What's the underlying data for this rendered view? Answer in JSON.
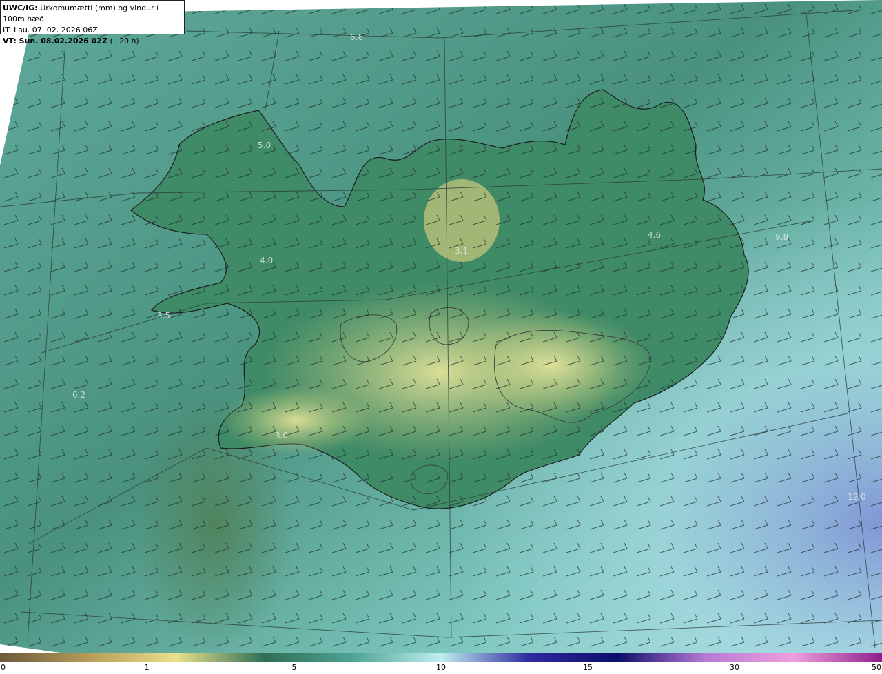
{
  "header": {
    "model_label": "UWC/IG:",
    "title": "Úrkomumætti (mm) og vindur í 100m hæð",
    "it_line": "IT: Lau. 07. 02. 2026 06Z",
    "vt_label": "VT: Sun. 08.02.2026 02Z",
    "vt_offset": "(+20 h)"
  },
  "colorbar": {
    "ticks": [
      "0",
      "1",
      "5",
      "10",
      "15",
      "30",
      "50"
    ],
    "colors": [
      "#6b5a3a",
      "#b79b5a",
      "#e9e08c",
      "#2f6e55",
      "#4fa394",
      "#bfeef0",
      "#2f2aa0",
      "#0b0e6a",
      "#b87ad6",
      "#ee9fdd",
      "#8e1e8e"
    ]
  },
  "map_values": [
    "6.6",
    "5.0",
    "4.0",
    "3.5",
    "3.1",
    "4.6",
    "6.2",
    "3.0",
    "9.8",
    "12.0"
  ]
}
